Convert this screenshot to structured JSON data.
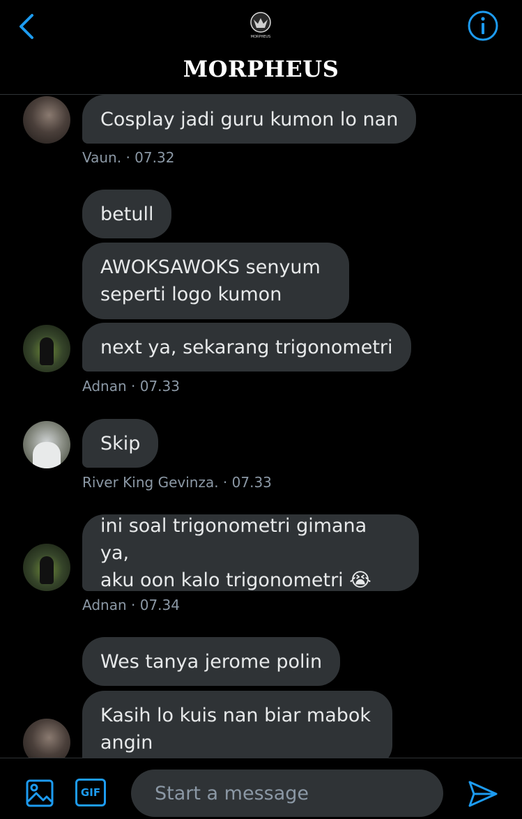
{
  "header": {
    "title": "MORPHEUS",
    "logo_text": "MORPHEUS",
    "back_icon": "chevron-left-icon",
    "info_icon": "info-circle-icon"
  },
  "messages": [
    {
      "text": "Cosplay jadi guru kumon lo nan"
    },
    {
      "sender": "Vaun.",
      "time": "· 07.32"
    },
    {
      "text": "betull"
    },
    {
      "text": "AWOKSAWOKS senyum\nseperti logo kumon"
    },
    {
      "text": "next ya, sekarang trigonometri"
    },
    {
      "sender": "Adnan",
      "time": "· 07.33"
    },
    {
      "text": "Skip"
    },
    {
      "sender": "River King Gevinza.",
      "time": "· 07.33"
    },
    {
      "text": "ini soal trigonometri gimana ya,\naku oon kalo trigonometri 😭"
    },
    {
      "sender": "Adnan",
      "time": "· 07.34"
    },
    {
      "text": "Wes tanya jerome polin"
    },
    {
      "text": "Kasih lo kuis nan biar mabok\nangin"
    }
  ],
  "composer": {
    "placeholder": "Start a message",
    "gif_label": "GIF",
    "image_icon": "image-icon",
    "send_icon": "send-icon"
  },
  "colors": {
    "accent": "#1d9bf0",
    "bubble": "#2f3336",
    "background": "#000000",
    "meta_text": "#8b98a5"
  }
}
